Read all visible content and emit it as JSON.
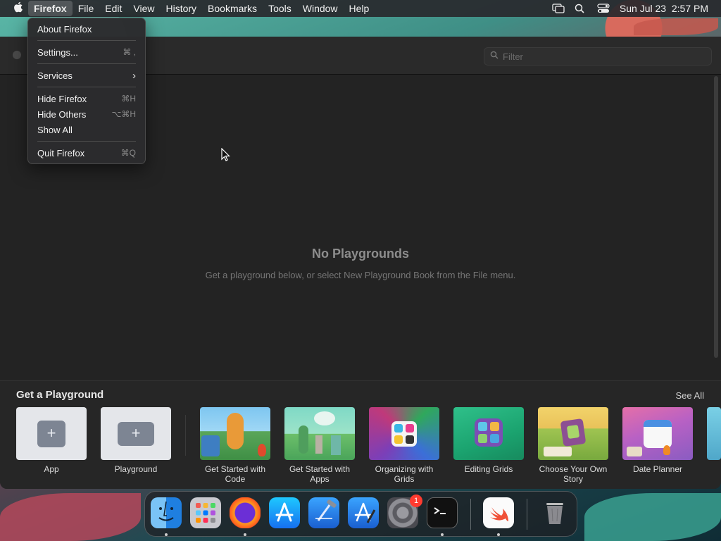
{
  "menubar": {
    "apple": "",
    "items": [
      "Firefox",
      "File",
      "Edit",
      "View",
      "History",
      "Bookmarks",
      "Tools",
      "Window",
      "Help"
    ],
    "clock": "Sun Jul 23  2:57 PM"
  },
  "app_menu": {
    "items": [
      {
        "label": "About Firefox",
        "shortcut": ""
      },
      {
        "label": "Settings...",
        "shortcut": "⌘ ,"
      },
      {
        "label": "Services",
        "shortcut": "›"
      },
      {
        "label": "Hide Firefox",
        "shortcut": "⌘H"
      },
      {
        "label": "Hide Others",
        "shortcut": "⌥⌘H"
      },
      {
        "label": "Show All",
        "shortcut": ""
      },
      {
        "label": "Quit Firefox",
        "shortcut": "⌘Q"
      }
    ]
  },
  "window": {
    "filter_placeholder": "Filter",
    "empty_title": "No Playgrounds",
    "empty_subtitle": "Get a playground below, or select New Playground Book from the File menu."
  },
  "shelf": {
    "title": "Get a Playground",
    "see_all": "See All",
    "tiles": [
      {
        "label": "App"
      },
      {
        "label": "Playground"
      },
      {
        "label": "Get Started with Code"
      },
      {
        "label": "Get Started with Apps"
      },
      {
        "label": "Organizing with Grids"
      },
      {
        "label": "Editing Grids"
      },
      {
        "label": "Choose Your Own Story"
      },
      {
        "label": "Date Planner"
      }
    ]
  },
  "dock": {
    "apps": [
      "finder-icon",
      "launchpad-icon",
      "firefox-icon",
      "app-store-icon",
      "xcode-icon",
      "xcode-beta-icon",
      "system-settings-icon",
      "terminal-icon",
      "swift-playgrounds-icon",
      "trash-icon"
    ],
    "settings_badge": "1"
  },
  "colors": {
    "accent": "#0a84ff",
    "menubar": "#28282c",
    "window_bg": "#232323"
  }
}
